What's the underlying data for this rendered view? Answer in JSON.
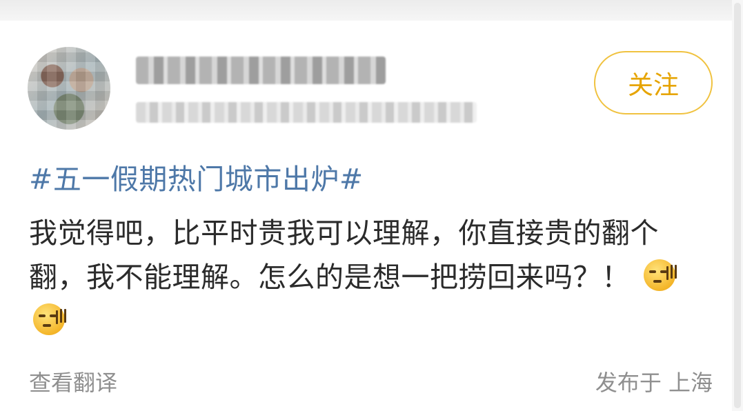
{
  "post": {
    "follow_label": "关注",
    "hashtag": "#五一假期热门城市出炉#",
    "body": "我觉得吧，比平时贵我可以理解，你直接贵的翻个翻，我不能理解。怎么的是想一把捞回来吗？！",
    "emojis": [
      "sweat-emoji",
      "sweat-emoji"
    ],
    "translate_label": "查看翻译",
    "location_label": "发布于 上海"
  },
  "colors": {
    "hashtag": "#4e78a8",
    "follow_accent": "#e6a400",
    "secondary_text": "#8f8f8f"
  }
}
